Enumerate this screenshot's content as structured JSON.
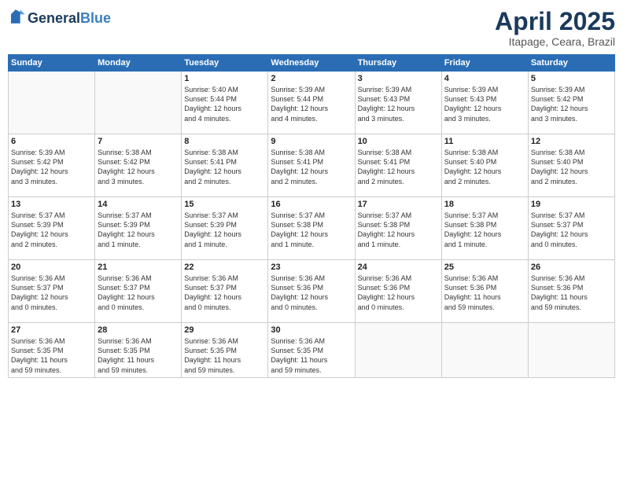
{
  "header": {
    "logo_line1": "General",
    "logo_line2": "Blue",
    "month_year": "April 2025",
    "location": "Itapage, Ceara, Brazil"
  },
  "weekdays": [
    "Sunday",
    "Monday",
    "Tuesday",
    "Wednesday",
    "Thursday",
    "Friday",
    "Saturday"
  ],
  "weeks": [
    [
      {
        "day": "",
        "info": ""
      },
      {
        "day": "",
        "info": ""
      },
      {
        "day": "1",
        "info": "Sunrise: 5:40 AM\nSunset: 5:44 PM\nDaylight: 12 hours\nand 4 minutes."
      },
      {
        "day": "2",
        "info": "Sunrise: 5:39 AM\nSunset: 5:44 PM\nDaylight: 12 hours\nand 4 minutes."
      },
      {
        "day": "3",
        "info": "Sunrise: 5:39 AM\nSunset: 5:43 PM\nDaylight: 12 hours\nand 3 minutes."
      },
      {
        "day": "4",
        "info": "Sunrise: 5:39 AM\nSunset: 5:43 PM\nDaylight: 12 hours\nand 3 minutes."
      },
      {
        "day": "5",
        "info": "Sunrise: 5:39 AM\nSunset: 5:42 PM\nDaylight: 12 hours\nand 3 minutes."
      }
    ],
    [
      {
        "day": "6",
        "info": "Sunrise: 5:39 AM\nSunset: 5:42 PM\nDaylight: 12 hours\nand 3 minutes."
      },
      {
        "day": "7",
        "info": "Sunrise: 5:38 AM\nSunset: 5:42 PM\nDaylight: 12 hours\nand 3 minutes."
      },
      {
        "day": "8",
        "info": "Sunrise: 5:38 AM\nSunset: 5:41 PM\nDaylight: 12 hours\nand 2 minutes."
      },
      {
        "day": "9",
        "info": "Sunrise: 5:38 AM\nSunset: 5:41 PM\nDaylight: 12 hours\nand 2 minutes."
      },
      {
        "day": "10",
        "info": "Sunrise: 5:38 AM\nSunset: 5:41 PM\nDaylight: 12 hours\nand 2 minutes."
      },
      {
        "day": "11",
        "info": "Sunrise: 5:38 AM\nSunset: 5:40 PM\nDaylight: 12 hours\nand 2 minutes."
      },
      {
        "day": "12",
        "info": "Sunrise: 5:38 AM\nSunset: 5:40 PM\nDaylight: 12 hours\nand 2 minutes."
      }
    ],
    [
      {
        "day": "13",
        "info": "Sunrise: 5:37 AM\nSunset: 5:39 PM\nDaylight: 12 hours\nand 2 minutes."
      },
      {
        "day": "14",
        "info": "Sunrise: 5:37 AM\nSunset: 5:39 PM\nDaylight: 12 hours\nand 1 minute."
      },
      {
        "day": "15",
        "info": "Sunrise: 5:37 AM\nSunset: 5:39 PM\nDaylight: 12 hours\nand 1 minute."
      },
      {
        "day": "16",
        "info": "Sunrise: 5:37 AM\nSunset: 5:38 PM\nDaylight: 12 hours\nand 1 minute."
      },
      {
        "day": "17",
        "info": "Sunrise: 5:37 AM\nSunset: 5:38 PM\nDaylight: 12 hours\nand 1 minute."
      },
      {
        "day": "18",
        "info": "Sunrise: 5:37 AM\nSunset: 5:38 PM\nDaylight: 12 hours\nand 1 minute."
      },
      {
        "day": "19",
        "info": "Sunrise: 5:37 AM\nSunset: 5:37 PM\nDaylight: 12 hours\nand 0 minutes."
      }
    ],
    [
      {
        "day": "20",
        "info": "Sunrise: 5:36 AM\nSunset: 5:37 PM\nDaylight: 12 hours\nand 0 minutes."
      },
      {
        "day": "21",
        "info": "Sunrise: 5:36 AM\nSunset: 5:37 PM\nDaylight: 12 hours\nand 0 minutes."
      },
      {
        "day": "22",
        "info": "Sunrise: 5:36 AM\nSunset: 5:37 PM\nDaylight: 12 hours\nand 0 minutes."
      },
      {
        "day": "23",
        "info": "Sunrise: 5:36 AM\nSunset: 5:36 PM\nDaylight: 12 hours\nand 0 minutes."
      },
      {
        "day": "24",
        "info": "Sunrise: 5:36 AM\nSunset: 5:36 PM\nDaylight: 12 hours\nand 0 minutes."
      },
      {
        "day": "25",
        "info": "Sunrise: 5:36 AM\nSunset: 5:36 PM\nDaylight: 11 hours\nand 59 minutes."
      },
      {
        "day": "26",
        "info": "Sunrise: 5:36 AM\nSunset: 5:36 PM\nDaylight: 11 hours\nand 59 minutes."
      }
    ],
    [
      {
        "day": "27",
        "info": "Sunrise: 5:36 AM\nSunset: 5:35 PM\nDaylight: 11 hours\nand 59 minutes."
      },
      {
        "day": "28",
        "info": "Sunrise: 5:36 AM\nSunset: 5:35 PM\nDaylight: 11 hours\nand 59 minutes."
      },
      {
        "day": "29",
        "info": "Sunrise: 5:36 AM\nSunset: 5:35 PM\nDaylight: 11 hours\nand 59 minutes."
      },
      {
        "day": "30",
        "info": "Sunrise: 5:36 AM\nSunset: 5:35 PM\nDaylight: 11 hours\nand 59 minutes."
      },
      {
        "day": "",
        "info": ""
      },
      {
        "day": "",
        "info": ""
      },
      {
        "day": "",
        "info": ""
      }
    ]
  ]
}
